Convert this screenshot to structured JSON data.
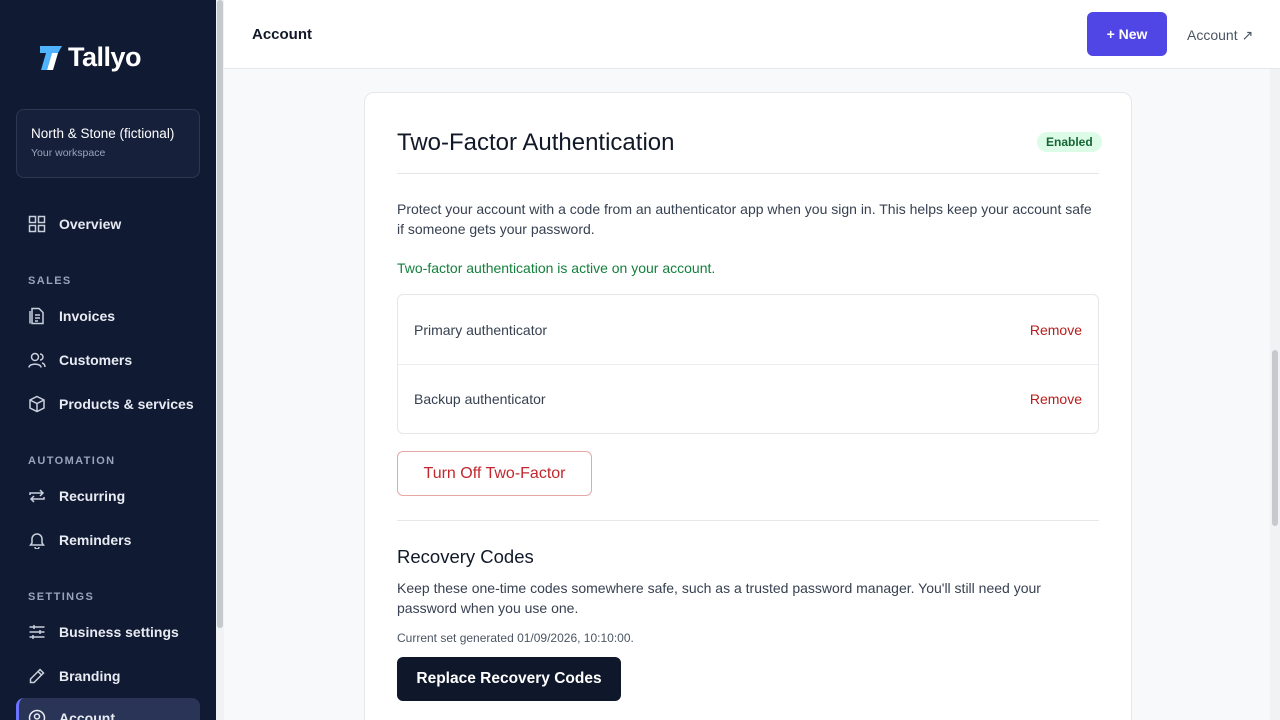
{
  "brand": {
    "name": "Tallyo",
    "accent": "#4f46e5",
    "sidebar_bg": "#101a33"
  },
  "workspace": {
    "name": "North & Stone (fictional)",
    "subtitle": "Your workspace"
  },
  "sidebar": {
    "overview": {
      "label": "Overview",
      "icon": "grid-icon"
    },
    "sections": {
      "sales": "SALES",
      "automation": "AUTOMATION",
      "settings": "SETTINGS"
    },
    "items": {
      "invoices": {
        "label": "Invoices",
        "icon": "invoice-icon"
      },
      "customers": {
        "label": "Customers",
        "icon": "users-icon"
      },
      "products": {
        "label": "Products & services",
        "icon": "box-icon"
      },
      "recurring": {
        "label": "Recurring",
        "icon": "repeat-icon"
      },
      "reminders": {
        "label": "Reminders",
        "icon": "bell-icon"
      },
      "business_settings": {
        "label": "Business settings",
        "icon": "sliders-icon"
      },
      "branding": {
        "label": "Branding",
        "icon": "pen-icon"
      },
      "account": {
        "label": "Account",
        "icon": "user-circle-icon"
      }
    }
  },
  "header": {
    "title": "Account",
    "new_label": "+ New",
    "account_link": "Account ↗"
  },
  "two_factor": {
    "title": "Two-Factor Authentication",
    "status": "Enabled",
    "description": "Protect your account with a code from an authenticator app when you sign in. This helps keep your account safe if someone gets your password.",
    "active_note": "Two-factor authentication is active on your account.",
    "authenticators": [
      {
        "name": "Primary authenticator",
        "action": "Remove"
      },
      {
        "name": "Backup authenticator",
        "action": "Remove"
      }
    ],
    "turn_off_label": "Turn Off Two-Factor"
  },
  "recovery": {
    "title": "Recovery Codes",
    "description": "Keep these one-time codes somewhere safe, such as a trusted password manager. You'll still need your password when you use one.",
    "generated": "Current set generated 01/09/2026, 10:10:00.",
    "replace_label": "Replace Recovery Codes"
  }
}
